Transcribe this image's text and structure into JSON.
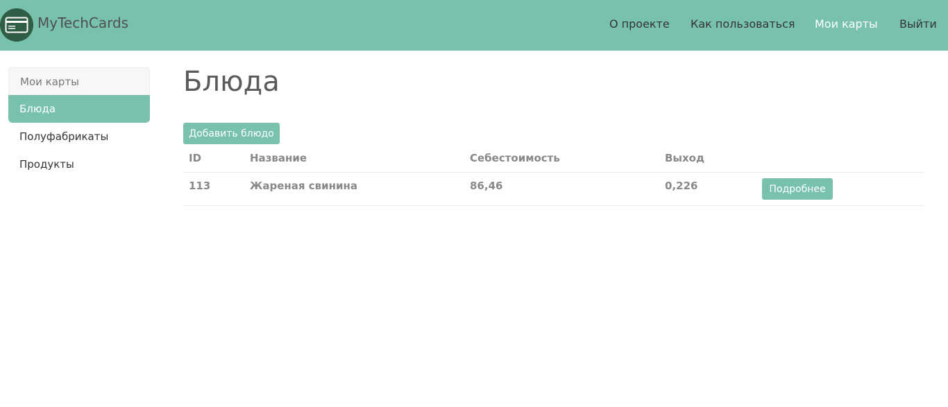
{
  "navbar": {
    "brand": "MyTechCards",
    "brand_icon": "credit-card-icon",
    "items": [
      {
        "label": "О проекте",
        "active": false
      },
      {
        "label": "Как пользоваться",
        "active": false
      },
      {
        "label": "Мои карты",
        "active": true
      },
      {
        "label": "Выйти",
        "active": false
      }
    ]
  },
  "sidebar": {
    "header": "Мои карты",
    "items": [
      {
        "label": "Блюда",
        "active": true
      },
      {
        "label": "Полуфабрикаты",
        "active": false
      },
      {
        "label": "Продукты",
        "active": false
      }
    ]
  },
  "main": {
    "title": "Блюда",
    "add_button": "Добавить блюдо",
    "table": {
      "columns": [
        "ID",
        "Название",
        "Себестоимость",
        "Выход"
      ],
      "rows": [
        {
          "id": "113",
          "name": "Жареная свинина",
          "cost": "86,46",
          "output": "0,226",
          "action": "Подробнее"
        }
      ]
    }
  },
  "colors": {
    "primary": "#78c2ad",
    "logo_bg": "#2f5e45",
    "muted_text": "#888888"
  }
}
